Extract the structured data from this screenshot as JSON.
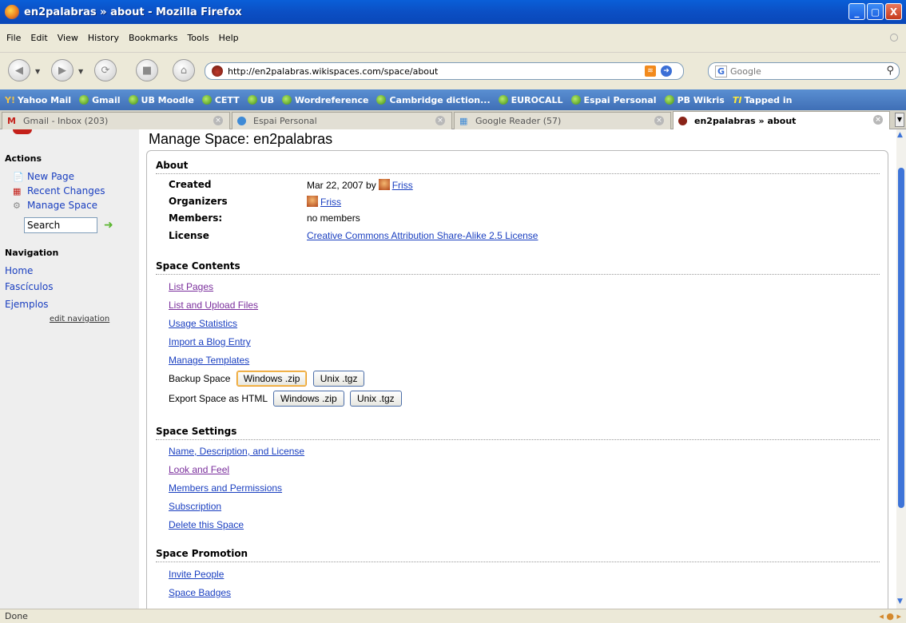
{
  "window": {
    "title": "en2palabras » about - Mozilla Firefox",
    "min": "_",
    "max": "▢",
    "close": "X"
  },
  "menu": [
    "File",
    "Edit",
    "View",
    "History",
    "Bookmarks",
    "Tools",
    "Help"
  ],
  "nav": {
    "url": "http://en2palabras.wikispaces.com/space/about",
    "search_placeholder": "Google",
    "search_engine": "G"
  },
  "bookmarks": [
    "Yahoo Mail",
    "Gmail",
    "UB Moodle",
    "CETT",
    "UB",
    "Wordreference",
    "Cambridge diction...",
    "EUROCALL",
    "Espai Personal",
    "PB Wikris",
    "Tapped in"
  ],
  "tabs": [
    {
      "label": "Gmail - Inbox (203)"
    },
    {
      "label": "Espai Personal"
    },
    {
      "label": "Google Reader (57)"
    },
    {
      "label": "en2palabras » about"
    }
  ],
  "sidebar": {
    "actions_heading": "Actions",
    "actions": [
      "New Page",
      "Recent Changes",
      "Manage Space"
    ],
    "search_value": "Search",
    "navigation_heading": "Navigation",
    "nav_links": [
      "Home",
      "Fascículos",
      "Ejemplos"
    ],
    "edit_navigation": "edit navigation"
  },
  "page": {
    "title": "Manage Space: en2palabras",
    "about": {
      "heading": "About",
      "created_label": "Created",
      "created_value": "Mar 22, 2007 by",
      "created_user": "Friss",
      "organizers_label": "Organizers",
      "organizer": "Friss",
      "members_label": "Members:",
      "members_value": "no members",
      "license_label": "License",
      "license_value": "Creative Commons Attribution Share-Alike 2.5 License"
    },
    "contents": {
      "heading": "Space Contents",
      "links": [
        "List Pages",
        "List and Upload Files",
        "Usage Statistics",
        "Import a Blog Entry",
        "Manage Templates"
      ],
      "backup_label": "Backup Space",
      "export_label": "Export Space as HTML",
      "btn_windows": "Windows .zip",
      "btn_unix": "Unix .tgz"
    },
    "settings": {
      "heading": "Space Settings",
      "links": [
        "Name, Description, and License",
        "Look and Feel",
        "Members and Permissions",
        "Subscription",
        "Delete this Space"
      ]
    },
    "promotion": {
      "heading": "Space Promotion",
      "links": [
        "Invite People",
        "Space Badges"
      ]
    }
  },
  "status": {
    "text": "Done"
  }
}
